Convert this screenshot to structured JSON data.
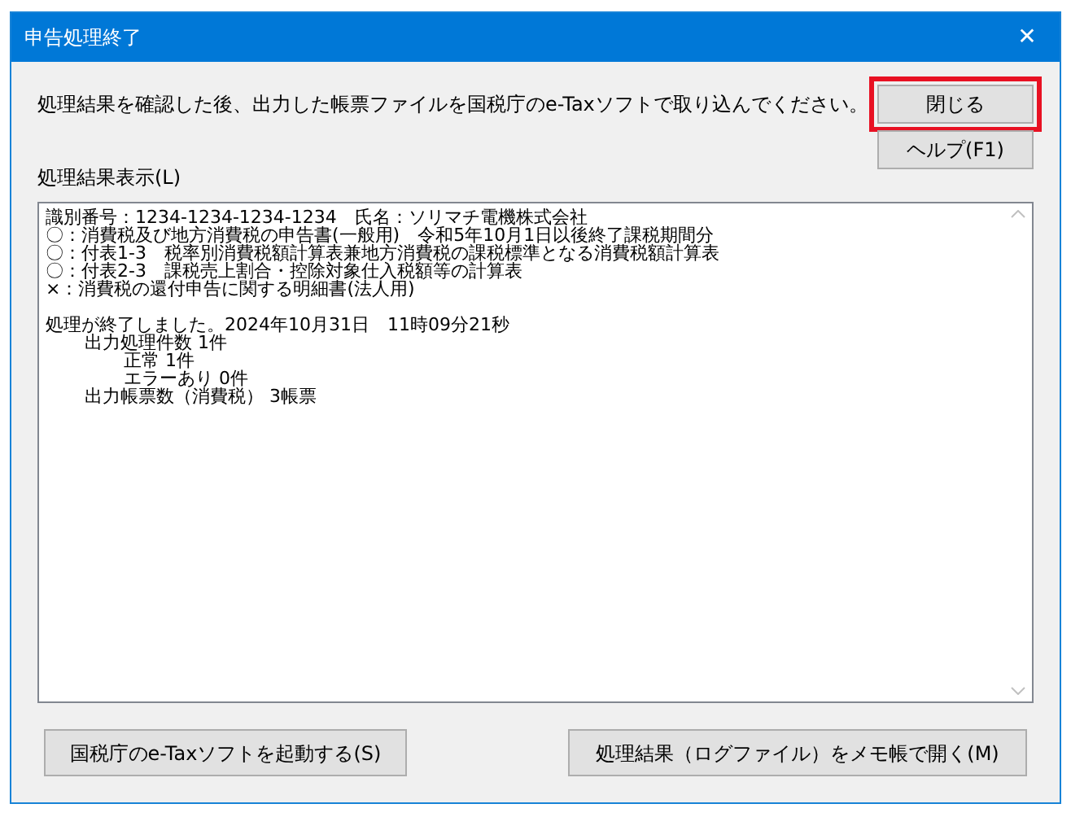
{
  "window": {
    "title": "申告処理終了",
    "close": "✕"
  },
  "instruction": "処理結果を確認した後、出力した帳票ファイルを国税庁のe-Taxソフトで取り込んでください。",
  "buttons_top": [
    {
      "label": "閉じる",
      "highlighted": true
    },
    {
      "label": "ヘルプ(F1)",
      "highlighted": false
    }
  ],
  "result_label": "処理結果表示(L)",
  "log": [
    {
      "text": "識別番号：1234-1234-1234-1234　氏名：ソリマチ電機株式会社"
    },
    {
      "text": "〇：消費税及び地方消費税の申告書(一般用)　令和5年10月1日以後終了課税期間分"
    },
    {
      "text": "〇：付表1-3　税率別消費税額計算表兼地方消費税の課税標準となる消費税額計算表"
    },
    {
      "text": "〇：付表2-3　課税売上割合・控除対象仕入税額等の計算表"
    },
    {
      "text": "×：消費税の還付申告に関する明細書(法人用)",
      "gap_after": true
    },
    {
      "text": "処理が終了しました。2024年10月31日　11時09分21秒",
      "children": [
        {
          "text": "出力処理件数 1件",
          "children": [
            {
              "text": "正常 1件"
            },
            {
              "text": "エラーあり 0件"
            }
          ]
        },
        {
          "text": "出力帳票数（消費税） 3帳票"
        }
      ]
    }
  ],
  "buttons_bottom": [
    {
      "label": "国税庁のe-Taxソフトを起動する(S)"
    },
    {
      "label": "処理結果（ログファイル）をメモ帳で開く(M)"
    }
  ]
}
